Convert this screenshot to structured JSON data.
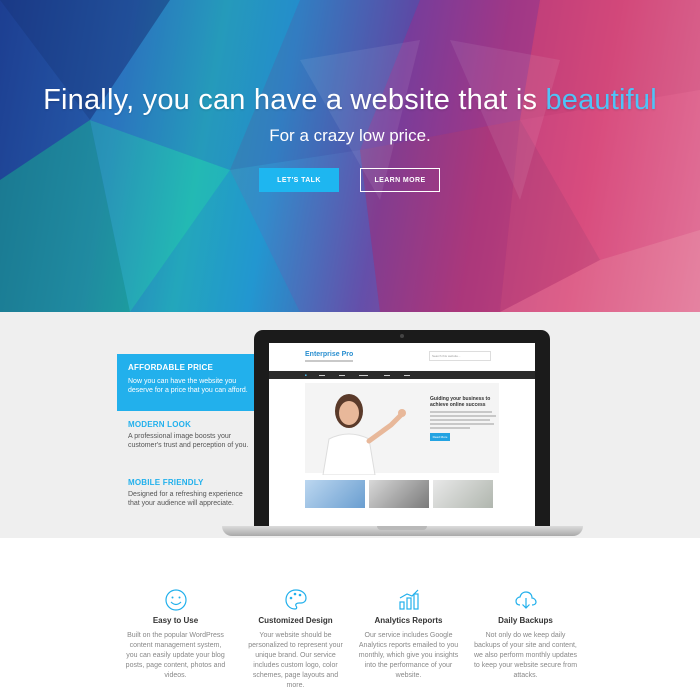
{
  "hero": {
    "title_main": "Finally, you can have a website that is ",
    "title_accent": "beautiful",
    "subtitle": "For a crazy low price.",
    "primary_cta": "LET'S TALK",
    "secondary_cta": "LEARN MORE"
  },
  "features": [
    {
      "title": "AFFORDABLE PRICE",
      "desc": "Now you can have the website you deserve for a price that you can afford."
    },
    {
      "title": "MODERN LOOK",
      "desc": "A professional image boosts your customer's trust and perception of you."
    },
    {
      "title": "MOBILE FRIENDLY",
      "desc": "Designed for a refreshing experience that your audience will appreciate."
    }
  ],
  "laptop_site": {
    "logo": "Enterprise Pro",
    "search_placeholder": "Search this website...",
    "headline": "Guiding your business to achieve online success",
    "button": "Read More"
  },
  "services": [
    {
      "icon": "smiley-icon",
      "title": "Easy to Use",
      "desc": "Built on the popular WordPress content management system, you can easily update your blog posts, page content, photos and videos."
    },
    {
      "icon": "palette-icon",
      "title": "Customized Design",
      "desc": "Your website should be personalized to represent your unique brand. Our service includes custom logo, color schemes, page layouts and more."
    },
    {
      "icon": "chart-icon",
      "title": "Analytics Reports",
      "desc": "Our service includes Google Analytics reports emailed to you monthly, which give you insights into the performance of your website."
    },
    {
      "icon": "cloud-download-icon",
      "title": "Daily Backups",
      "desc": "Not only do we keep daily backups of your site and content, we also perform monthly updates to keep your website secure from attacks."
    }
  ],
  "colors": {
    "accent": "#22b0ec",
    "dark": "#333333",
    "muted": "#888888"
  }
}
